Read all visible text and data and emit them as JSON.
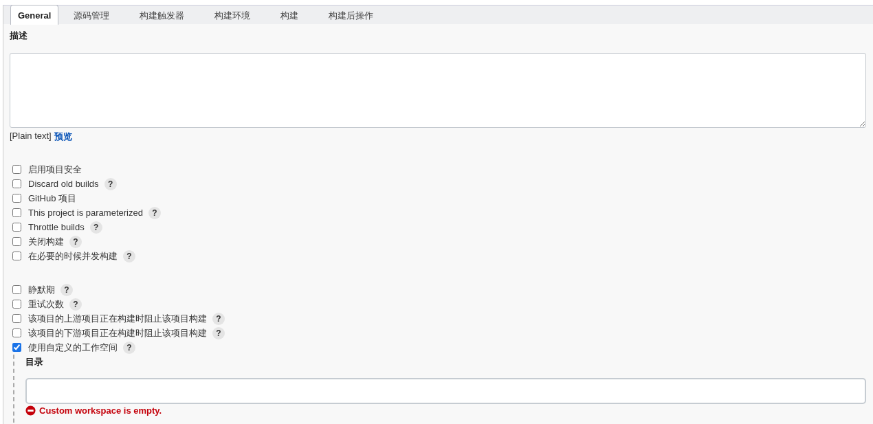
{
  "tabs": [
    {
      "label": "General",
      "selected": true
    },
    {
      "label": "源码管理",
      "selected": false
    },
    {
      "label": "构建触发器",
      "selected": false
    },
    {
      "label": "构建环境",
      "selected": false
    },
    {
      "label": "构建",
      "selected": false
    },
    {
      "label": "构建后操作",
      "selected": false
    }
  ],
  "description": {
    "label": "描述",
    "format_note": "[Plain text]",
    "preview_link": "预览"
  },
  "option_groups": [
    [
      {
        "label": "启用项目安全",
        "checked": false
      },
      {
        "label": "Discard old builds",
        "checked": false,
        "help": "?"
      },
      {
        "label": "GitHub 项目",
        "checked": false
      },
      {
        "label": "This project is parameterized",
        "checked": false,
        "help": "?"
      },
      {
        "label": "Throttle builds",
        "checked": false,
        "help": "?"
      },
      {
        "label": "关闭构建",
        "checked": false,
        "help": "?"
      },
      {
        "label": "在必要的时候并发构建",
        "checked": false,
        "help": "?"
      }
    ],
    [
      {
        "label": "静默期",
        "checked": false,
        "help": "?"
      },
      {
        "label": "重试次数",
        "checked": false,
        "help": "?"
      },
      {
        "label": "该项目的上游项目正在构建时阻止该项目构建",
        "checked": false,
        "help": "?"
      },
      {
        "label": "该项目的下游项目正在构建时阻止该项目构建",
        "checked": false,
        "help": "?"
      },
      {
        "label": "使用自定义的工作空间",
        "checked": true,
        "help": "?"
      }
    ]
  ],
  "custom_workspace": {
    "label": "目录",
    "error": "Custom workspace is empty."
  }
}
